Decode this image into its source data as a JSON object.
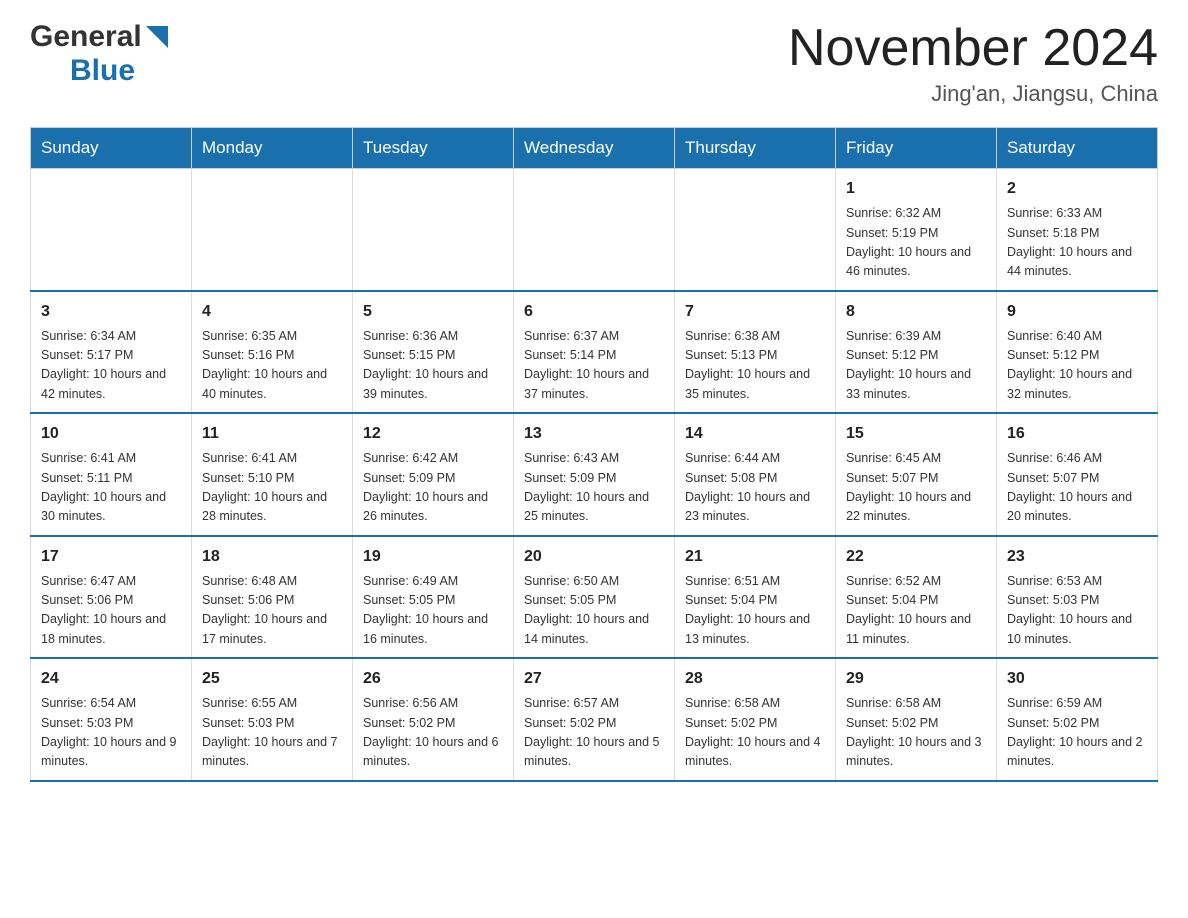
{
  "header": {
    "logo_general": "General",
    "logo_blue": "Blue",
    "title": "November 2024",
    "subtitle": "Jing'an, Jiangsu, China"
  },
  "weekdays": [
    "Sunday",
    "Monday",
    "Tuesday",
    "Wednesday",
    "Thursday",
    "Friday",
    "Saturday"
  ],
  "weeks": [
    [
      {
        "day": "",
        "info": ""
      },
      {
        "day": "",
        "info": ""
      },
      {
        "day": "",
        "info": ""
      },
      {
        "day": "",
        "info": ""
      },
      {
        "day": "",
        "info": ""
      },
      {
        "day": "1",
        "info": "Sunrise: 6:32 AM\nSunset: 5:19 PM\nDaylight: 10 hours and 46 minutes."
      },
      {
        "day": "2",
        "info": "Sunrise: 6:33 AM\nSunset: 5:18 PM\nDaylight: 10 hours and 44 minutes."
      }
    ],
    [
      {
        "day": "3",
        "info": "Sunrise: 6:34 AM\nSunset: 5:17 PM\nDaylight: 10 hours and 42 minutes."
      },
      {
        "day": "4",
        "info": "Sunrise: 6:35 AM\nSunset: 5:16 PM\nDaylight: 10 hours and 40 minutes."
      },
      {
        "day": "5",
        "info": "Sunrise: 6:36 AM\nSunset: 5:15 PM\nDaylight: 10 hours and 39 minutes."
      },
      {
        "day": "6",
        "info": "Sunrise: 6:37 AM\nSunset: 5:14 PM\nDaylight: 10 hours and 37 minutes."
      },
      {
        "day": "7",
        "info": "Sunrise: 6:38 AM\nSunset: 5:13 PM\nDaylight: 10 hours and 35 minutes."
      },
      {
        "day": "8",
        "info": "Sunrise: 6:39 AM\nSunset: 5:12 PM\nDaylight: 10 hours and 33 minutes."
      },
      {
        "day": "9",
        "info": "Sunrise: 6:40 AM\nSunset: 5:12 PM\nDaylight: 10 hours and 32 minutes."
      }
    ],
    [
      {
        "day": "10",
        "info": "Sunrise: 6:41 AM\nSunset: 5:11 PM\nDaylight: 10 hours and 30 minutes."
      },
      {
        "day": "11",
        "info": "Sunrise: 6:41 AM\nSunset: 5:10 PM\nDaylight: 10 hours and 28 minutes."
      },
      {
        "day": "12",
        "info": "Sunrise: 6:42 AM\nSunset: 5:09 PM\nDaylight: 10 hours and 26 minutes."
      },
      {
        "day": "13",
        "info": "Sunrise: 6:43 AM\nSunset: 5:09 PM\nDaylight: 10 hours and 25 minutes."
      },
      {
        "day": "14",
        "info": "Sunrise: 6:44 AM\nSunset: 5:08 PM\nDaylight: 10 hours and 23 minutes."
      },
      {
        "day": "15",
        "info": "Sunrise: 6:45 AM\nSunset: 5:07 PM\nDaylight: 10 hours and 22 minutes."
      },
      {
        "day": "16",
        "info": "Sunrise: 6:46 AM\nSunset: 5:07 PM\nDaylight: 10 hours and 20 minutes."
      }
    ],
    [
      {
        "day": "17",
        "info": "Sunrise: 6:47 AM\nSunset: 5:06 PM\nDaylight: 10 hours and 18 minutes."
      },
      {
        "day": "18",
        "info": "Sunrise: 6:48 AM\nSunset: 5:06 PM\nDaylight: 10 hours and 17 minutes."
      },
      {
        "day": "19",
        "info": "Sunrise: 6:49 AM\nSunset: 5:05 PM\nDaylight: 10 hours and 16 minutes."
      },
      {
        "day": "20",
        "info": "Sunrise: 6:50 AM\nSunset: 5:05 PM\nDaylight: 10 hours and 14 minutes."
      },
      {
        "day": "21",
        "info": "Sunrise: 6:51 AM\nSunset: 5:04 PM\nDaylight: 10 hours and 13 minutes."
      },
      {
        "day": "22",
        "info": "Sunrise: 6:52 AM\nSunset: 5:04 PM\nDaylight: 10 hours and 11 minutes."
      },
      {
        "day": "23",
        "info": "Sunrise: 6:53 AM\nSunset: 5:03 PM\nDaylight: 10 hours and 10 minutes."
      }
    ],
    [
      {
        "day": "24",
        "info": "Sunrise: 6:54 AM\nSunset: 5:03 PM\nDaylight: 10 hours and 9 minutes."
      },
      {
        "day": "25",
        "info": "Sunrise: 6:55 AM\nSunset: 5:03 PM\nDaylight: 10 hours and 7 minutes."
      },
      {
        "day": "26",
        "info": "Sunrise: 6:56 AM\nSunset: 5:02 PM\nDaylight: 10 hours and 6 minutes."
      },
      {
        "day": "27",
        "info": "Sunrise: 6:57 AM\nSunset: 5:02 PM\nDaylight: 10 hours and 5 minutes."
      },
      {
        "day": "28",
        "info": "Sunrise: 6:58 AM\nSunset: 5:02 PM\nDaylight: 10 hours and 4 minutes."
      },
      {
        "day": "29",
        "info": "Sunrise: 6:58 AM\nSunset: 5:02 PM\nDaylight: 10 hours and 3 minutes."
      },
      {
        "day": "30",
        "info": "Sunrise: 6:59 AM\nSunset: 5:02 PM\nDaylight: 10 hours and 2 minutes."
      }
    ]
  ]
}
